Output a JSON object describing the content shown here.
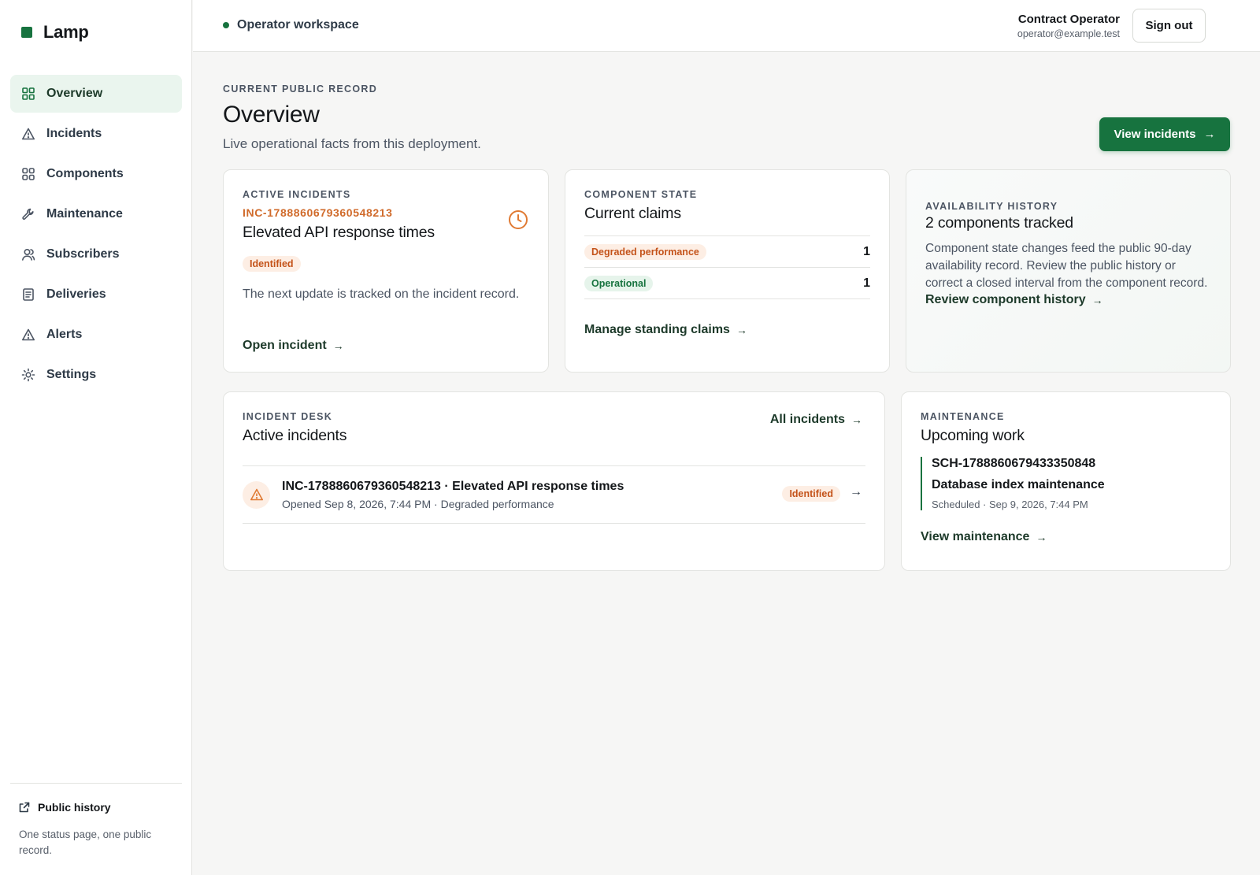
{
  "brand": {
    "name": "Lamp",
    "color": "#17733f"
  },
  "sidebar": {
    "items": [
      {
        "label": "Overview",
        "icon": "grid-icon",
        "active": true
      },
      {
        "label": "Incidents",
        "icon": "warning-icon"
      },
      {
        "label": "Components",
        "icon": "components-icon"
      },
      {
        "label": "Maintenance",
        "icon": "wrench-icon"
      },
      {
        "label": "Subscribers",
        "icon": "user-icon"
      },
      {
        "label": "Deliveries",
        "icon": "document-icon"
      },
      {
        "label": "Alerts",
        "icon": "warning-icon"
      },
      {
        "label": "Settings",
        "icon": "gear-icon"
      }
    ],
    "footer": {
      "link_label": "Public history",
      "note": "One status page, one public record."
    }
  },
  "topbar": {
    "workspace_label": "Operator workspace",
    "user_name": "Contract Operator",
    "user_email": "operator@example.test",
    "sign_out_label": "Sign out"
  },
  "header": {
    "eyebrow": "CURRENT PUBLIC RECORD",
    "title": "Overview",
    "subtitle": "Live operational facts from this deployment.",
    "primary_action": "View incidents"
  },
  "active_incident_card": {
    "eyebrow": "ACTIVE INCIDENTS",
    "incident_id": "INC-1788860679360548213",
    "title": "Elevated API response times",
    "status": "Identified",
    "description": "The next update is tracked on the incident record.",
    "link_label": "Open incident"
  },
  "component_state_card": {
    "eyebrow": "COMPONENT STATE",
    "title": "Current claims",
    "claims": [
      {
        "label": "Degraded performance",
        "count": "1",
        "tone": "orange"
      },
      {
        "label": "Operational",
        "count": "1",
        "tone": "green"
      }
    ],
    "link_label": "Manage standing claims"
  },
  "availability_card": {
    "eyebrow": "AVAILABILITY HISTORY",
    "title": "2 components tracked",
    "description": "Component state changes feed the public 90-day availability record. Review the public history or correct a closed interval from the component record.",
    "link_label": "Review component history"
  },
  "incident_desk": {
    "eyebrow": "INCIDENT DESK",
    "title": "Active incidents",
    "all_link": "All incidents",
    "rows": [
      {
        "title": "INC-1788860679360548213 · Elevated API response times",
        "meta": "Opened Sep 8, 2026, 7:44 PM · Degraded performance",
        "status": "Identified"
      }
    ]
  },
  "maintenance_card": {
    "eyebrow": "MAINTENANCE",
    "title": "Upcoming work",
    "item": {
      "id": "SCH-1788860679433350848",
      "title": "Database index maintenance",
      "meta": "Scheduled · Sep 9, 2026, 7:44 PM"
    },
    "link_label": "View maintenance"
  },
  "colors": {
    "accent": "#17733f",
    "warning": "#d06a2a",
    "background": "#f6f6f5"
  }
}
